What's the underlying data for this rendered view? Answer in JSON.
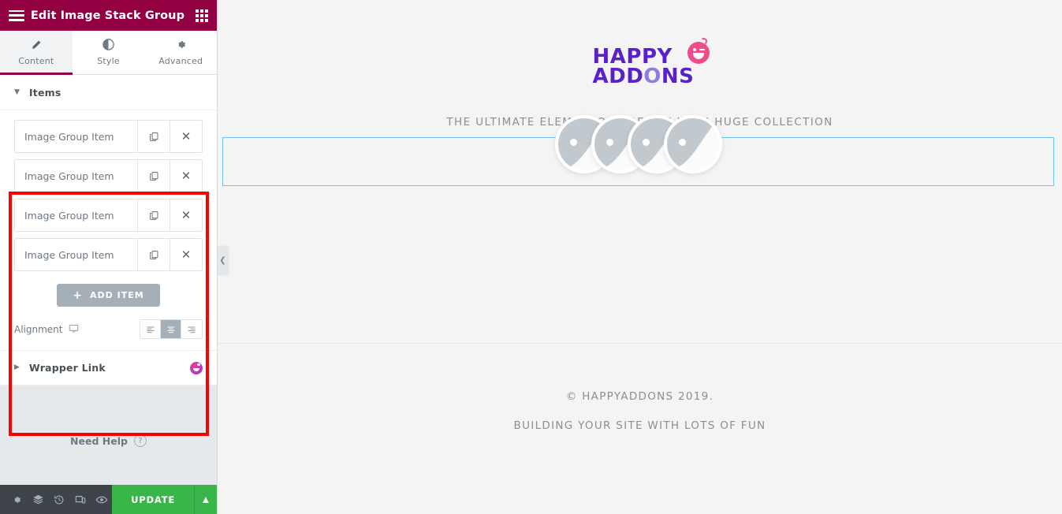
{
  "panel": {
    "header": {
      "title": "Edit Image Stack Group",
      "menu_icon": "hamburger-icon",
      "apps_icon": "grid-apps-icon"
    },
    "tabs": [
      {
        "label": "Content",
        "icon": "pencil-icon",
        "active": true
      },
      {
        "label": "Style",
        "icon": "contrast-circle-icon",
        "active": false
      },
      {
        "label": "Advanced",
        "icon": "gear-icon",
        "active": false
      }
    ],
    "sections": [
      {
        "title": "Items",
        "expanded": true
      },
      {
        "title": "Wrapper Link",
        "expanded": false,
        "badge": "happy-addons-icon"
      }
    ],
    "items": [
      {
        "label": "Image Group Item",
        "duplicate_icon": "copy-icon",
        "remove_icon": "close-x-icon"
      },
      {
        "label": "Image Group Item",
        "duplicate_icon": "copy-icon",
        "remove_icon": "close-x-icon"
      },
      {
        "label": "Image Group Item",
        "duplicate_icon": "copy-icon",
        "remove_icon": "close-x-icon"
      },
      {
        "label": "Image Group Item",
        "duplicate_icon": "copy-icon",
        "remove_icon": "close-x-icon"
      }
    ],
    "add_item_label": "ADD ITEM",
    "add_item_plus": "+",
    "alignment": {
      "label": "Alignment",
      "device_icon": "desktop-icon",
      "options": [
        {
          "value": "left",
          "icon": "align-left-icon",
          "selected": false
        },
        {
          "value": "center",
          "icon": "align-center-icon",
          "selected": true
        },
        {
          "value": "right",
          "icon": "align-right-icon",
          "selected": false
        }
      ]
    },
    "need_help": {
      "label": "Need Help",
      "icon": "question-mark-icon"
    },
    "footer": {
      "icons": [
        "settings-gear-icon",
        "layers-navigator-icon",
        "history-revisions-icon",
        "responsive-mode-icon",
        "preview-eye-icon"
      ],
      "update_label": "UPDATE",
      "update_caret": "▲"
    },
    "accent_color": "#930042",
    "highlight_color": "#fe0000",
    "update_color": "#39b54a"
  },
  "preview": {
    "logo": {
      "line1": "HAPPY",
      "line2_pre": "ADD",
      "line2_o": "O",
      "line2_post": "NS",
      "face_icon": "happy-face-icon",
      "purple": "#5b21c9",
      "pink": "#ef4c8b"
    },
    "tagline": "THE ULTIMATE ELEMENTOR ADDONS WITH HUGE COLLECTION",
    "stack": {
      "count": 4,
      "placeholder_icon": "image-placeholder-icon",
      "selection_color": "#6ec6f0"
    },
    "footer": {
      "line1": "© HAPPYADDONS 2019.",
      "line2": "BUILDING YOUR SITE WITH LOTS OF FUN"
    },
    "collapse_handle_icon": "chevron-left-icon"
  }
}
